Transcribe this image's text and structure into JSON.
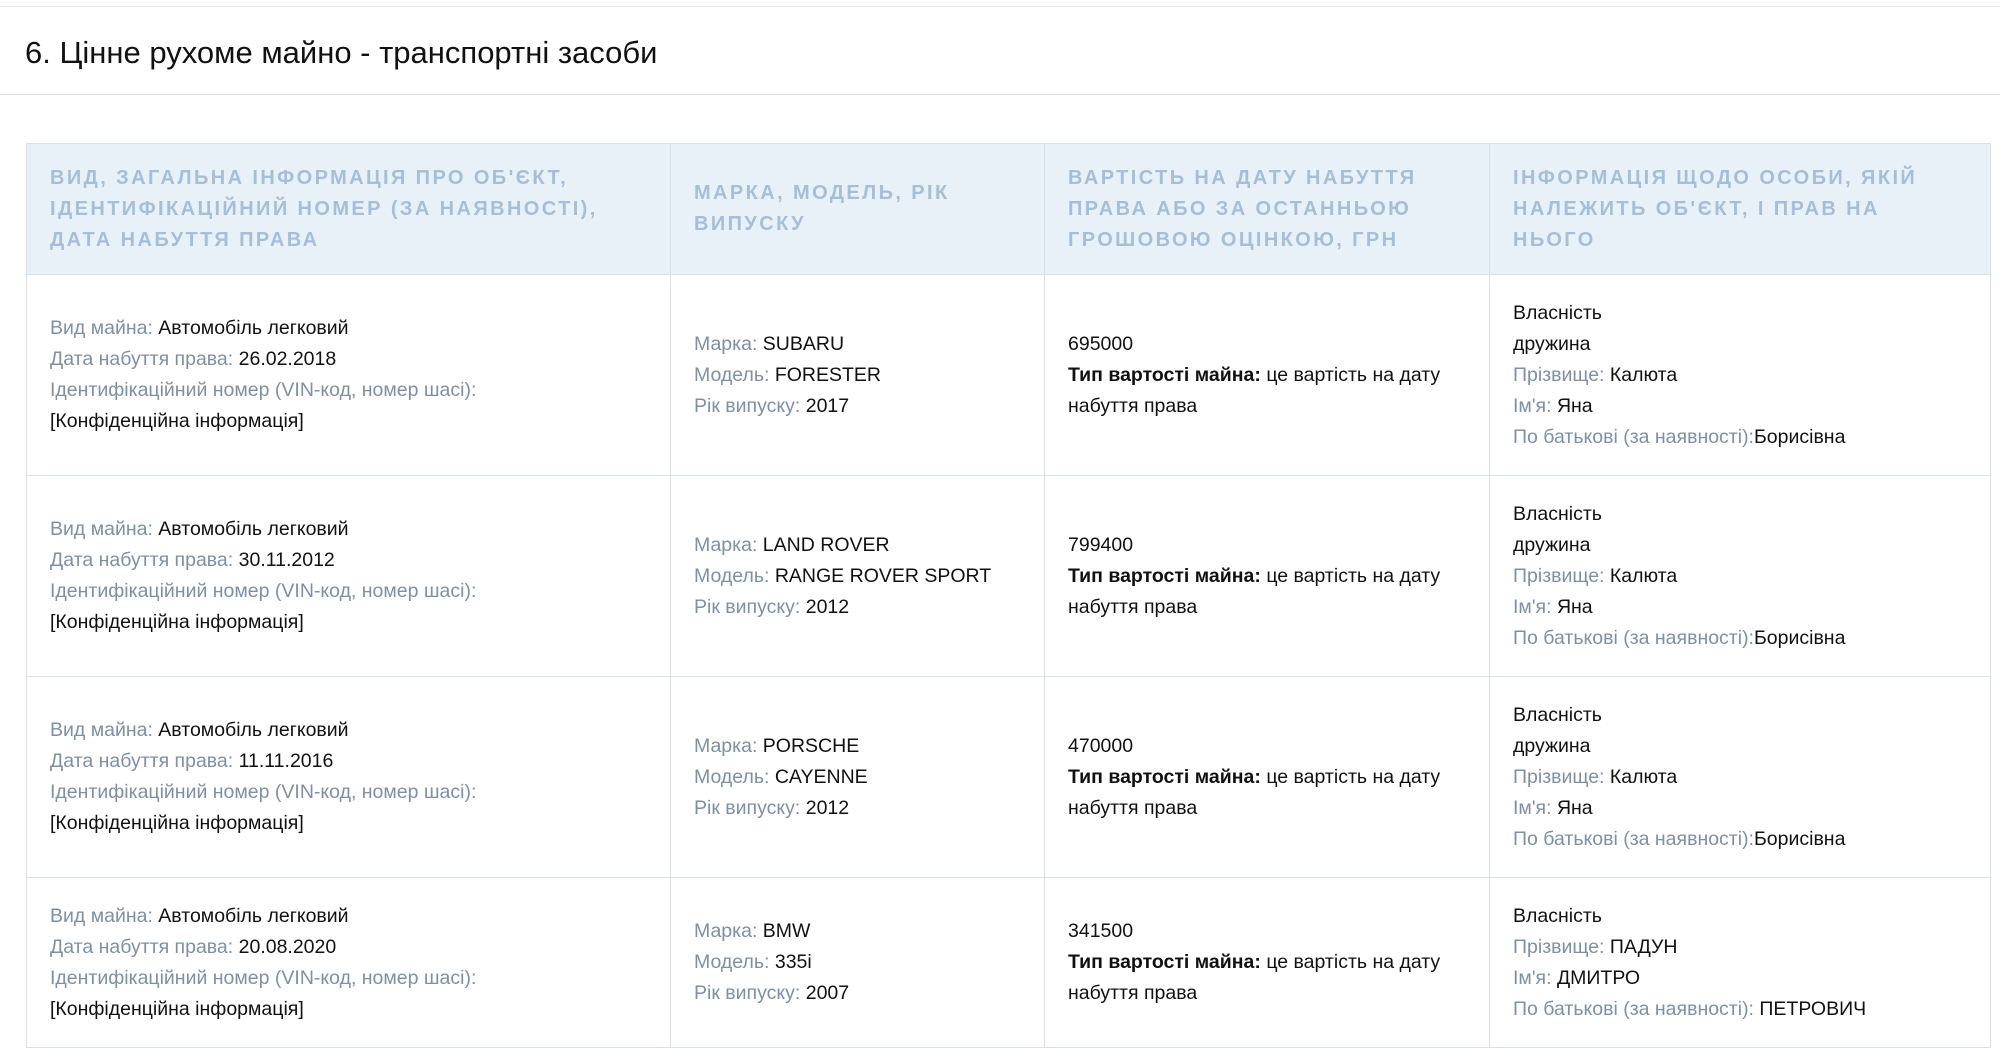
{
  "section": {
    "title": "6. Цінне рухоме майно - транспортні засоби"
  },
  "table": {
    "headers": [
      "ВИД, ЗАГАЛЬНА ІНФОРМАЦІЯ ПРО ОБ'ЄКТ, ІДЕНТИФІКАЦІЙНИЙ НОМЕР (ЗА НАЯВНОСТІ), ДАТА НАБУТТЯ ПРАВА",
      "МАРКА, МОДЕЛЬ, РІК ВИПУСКУ",
      "ВАРТІСТЬ НА ДАТУ НАБУТТЯ ПРАВА АБО ЗА ОСТАННЬОЮ ГРОШОВОЮ ОЦІНКОЮ, ГРН",
      "ІНФОРМАЦІЯ ЩОДО ОСОБИ, ЯКІЙ НАЛЕЖИТЬ ОБ'ЄКТ, І ПРАВ НА НЬОГО"
    ],
    "labels": {
      "type": "Вид майна:",
      "date": "Дата набуття права:",
      "vin": "Ідентифікаційний номер (VIN-код, номер шасі):",
      "brand": "Марка:",
      "model": "Модель:",
      "year": "Рік випуску:",
      "value_type": "Тип вартості майна:",
      "surname": "Прізвище:",
      "name": "Ім'я:",
      "patronymic": "По батькові (за наявності):"
    },
    "rows": [
      {
        "type": "Автомобіль легковий",
        "date": "26.02.2018",
        "vin": "[Конфіденційна інформація]",
        "brand": "SUBARU",
        "model": "FORESTER",
        "year": "2017",
        "value": "695000",
        "value_type": "це вартість на дату набуття права",
        "ownership": "Власність",
        "relation": "дружина",
        "surname": "Калюта",
        "name": "Яна",
        "patronymic": "Борисівна"
      },
      {
        "type": "Автомобіль легковий",
        "date": "30.11.2012",
        "vin": "[Конфіденційна інформація]",
        "brand": "LAND ROVER",
        "model": "RANGE ROVER SPORT",
        "year": "2012",
        "value": "799400",
        "value_type": "це вартість на дату набуття права",
        "ownership": "Власність",
        "relation": "дружина",
        "surname": "Калюта",
        "name": "Яна",
        "patronymic": "Борисівна"
      },
      {
        "type": "Автомобіль легковий",
        "date": "11.11.2016",
        "vin": "[Конфіденційна інформація]",
        "brand": "PORSCHE",
        "model": "CAYENNE",
        "year": "2012",
        "value": "470000",
        "value_type": "це вартість на дату набуття права",
        "ownership": "Власність",
        "relation": "дружина",
        "surname": "Калюта",
        "name": "Яна",
        "patronymic": "Борисівна"
      },
      {
        "type": "Автомобіль легковий",
        "date": "20.08.2020",
        "vin": "[Конфіденційна інформація]",
        "brand": "BMW",
        "model": "335i",
        "year": "2007",
        "value": "341500",
        "value_type": "це вартість на дату набуття права",
        "ownership": "Власність",
        "surname": "ПАДУН",
        "name": "ДМИТРО",
        "patronymic": "ПЕТРОВИЧ"
      }
    ]
  }
}
